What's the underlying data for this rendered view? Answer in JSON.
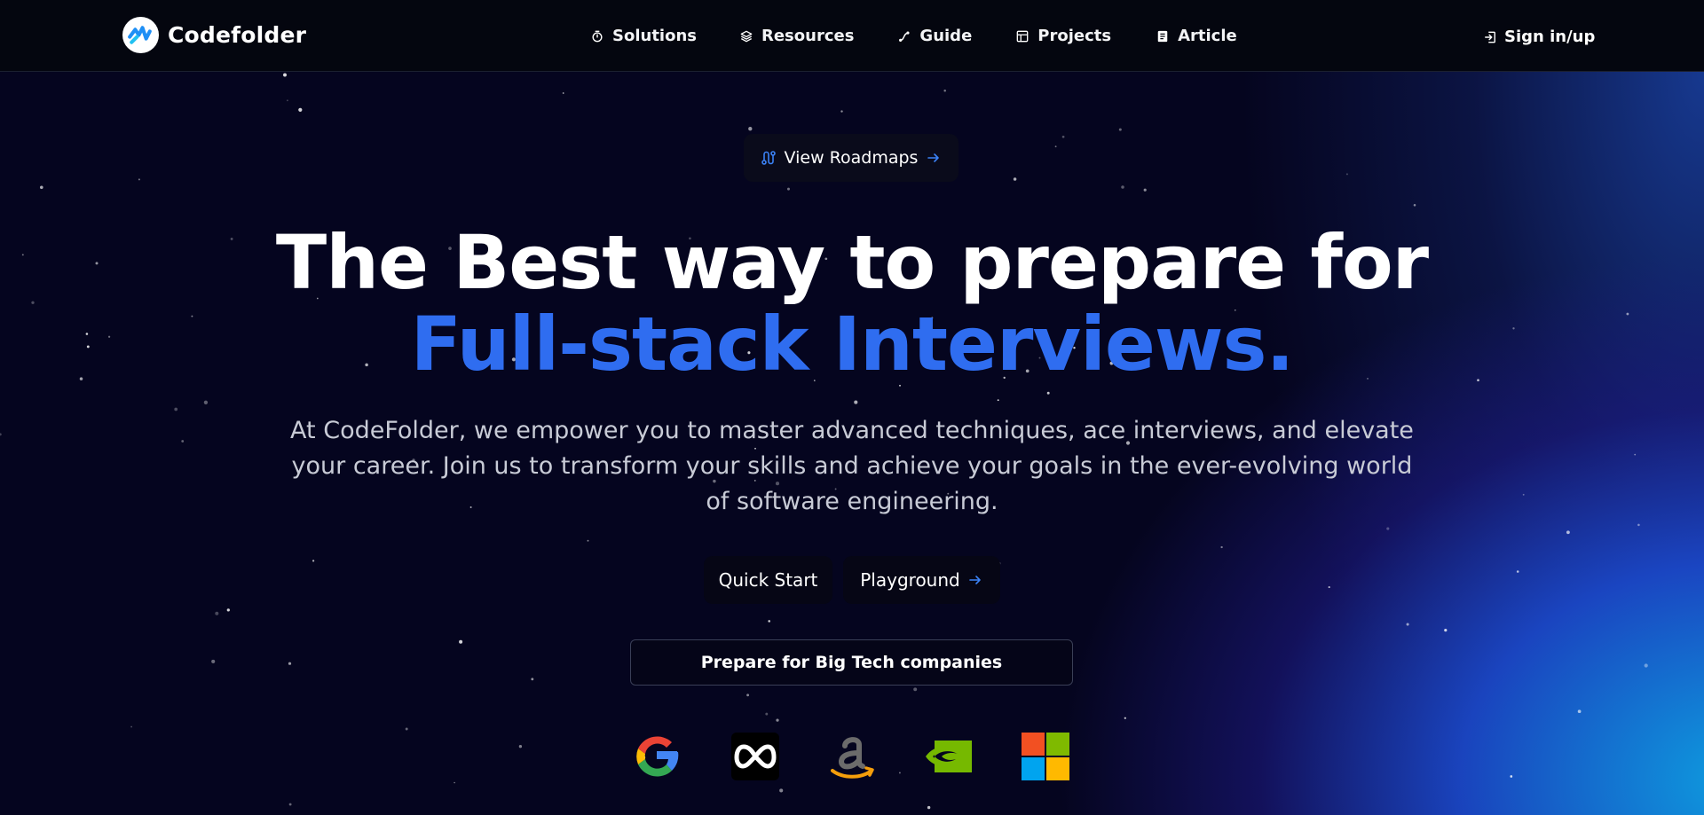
{
  "nav": {
    "brand": "Codefolder",
    "items": [
      {
        "label": "Solutions",
        "icon": "timer-icon"
      },
      {
        "label": "Resources",
        "icon": "layers-icon"
      },
      {
        "label": "Guide",
        "icon": "route-icon"
      },
      {
        "label": "Projects",
        "icon": "table-icon"
      },
      {
        "label": "Article",
        "icon": "document-icon"
      }
    ],
    "signin": "Sign in/up"
  },
  "hero": {
    "roadmap_button": "View Roadmaps",
    "headline_line1": "The Best way to prepare for",
    "headline_line2": "Full-stack Interviews.",
    "subtitle": "At CodeFolder, we empower you to master advanced techniques, ace interviews, and elevate your career. Join us to transform your skills and achieve your goals in the ever-evolving world of software engineering.",
    "quick_start": "Quick Start",
    "playground": "Playground",
    "bigtech_button": "Prepare for Big Tech companies"
  },
  "companies": [
    "google-logo",
    "meta-logo",
    "amazon-logo",
    "nvidia-logo",
    "microsoft-logo"
  ],
  "colors": {
    "accent": "#2f6df0",
    "background": "#05051f",
    "nav_background": "#04060f"
  }
}
